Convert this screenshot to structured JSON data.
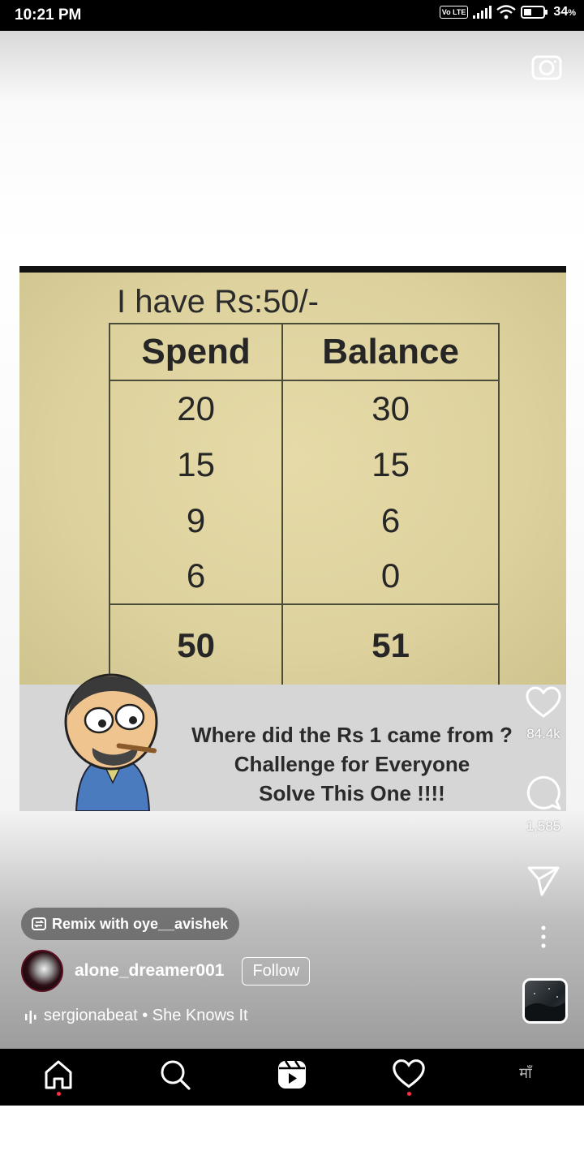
{
  "status_bar": {
    "time": "10:21 PM",
    "network_badge": "Vo LTE",
    "battery": "34",
    "battery_unit": "%"
  },
  "post": {
    "heading": "I have Rs:50/-",
    "columns": [
      "Spend",
      "Balance"
    ],
    "rows": [
      [
        "20",
        "30"
      ],
      [
        "15",
        "15"
      ],
      [
        "9",
        "6"
      ],
      [
        "6",
        "0"
      ]
    ],
    "totals": [
      "50",
      "51"
    ],
    "caption_lines": [
      "Where did the Rs 1 came from ?",
      "Challenge for Everyone",
      "Solve This One !!!!"
    ]
  },
  "actions": {
    "likes": "84.4k",
    "comments": "1,585"
  },
  "remix_label": "Remix with oye__avishek",
  "author": {
    "username": "alone_dreamer001",
    "follow_label": "Follow"
  },
  "audio": {
    "text": "sergionabeat • She Knows It"
  },
  "nav": {
    "profile_label": "माँ"
  },
  "colors": {
    "notification_dot": "#ff3040",
    "paper": "#ddd29e"
  }
}
